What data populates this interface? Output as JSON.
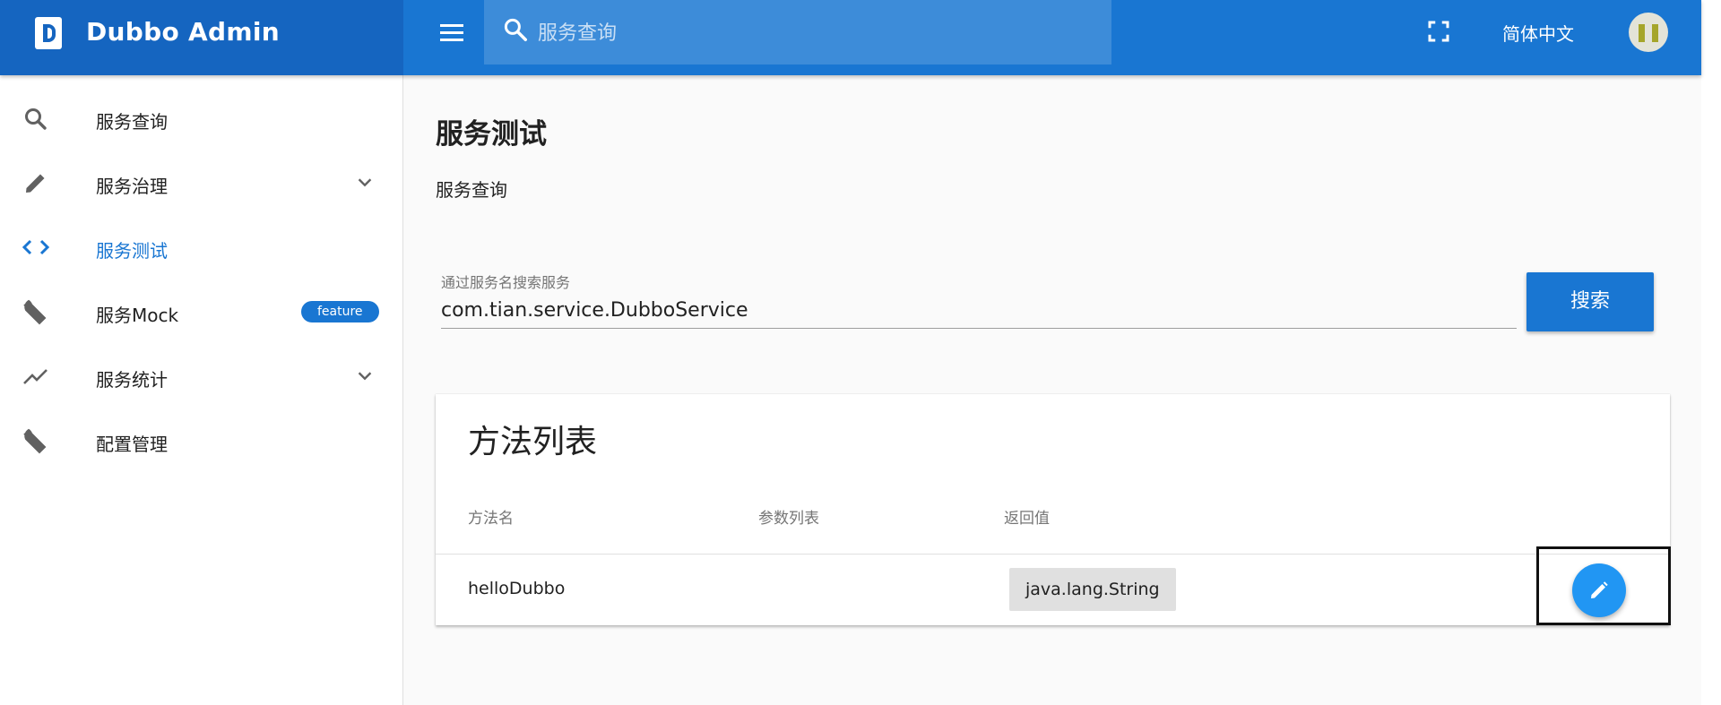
{
  "app": {
    "title": "Dubbo Admin"
  },
  "header": {
    "search_placeholder": "服务查询",
    "language": "简体中文"
  },
  "sidebar": {
    "items": [
      {
        "label": "服务查询",
        "icon": "search-icon"
      },
      {
        "label": "服务治理",
        "icon": "pencil-icon",
        "expandable": true
      },
      {
        "label": "服务测试",
        "icon": "code-icon",
        "active": true
      },
      {
        "label": "服务Mock",
        "icon": "wrench-icon",
        "badge": "feature"
      },
      {
        "label": "服务统计",
        "icon": "trending-icon",
        "expandable": true
      },
      {
        "label": "配置管理",
        "icon": "wrench-icon"
      }
    ]
  },
  "main": {
    "title": "服务测试",
    "breadcrumb": "服务查询",
    "search": {
      "label": "通过服务名搜索服务",
      "value": "com.tian.service.DubboService",
      "button": "搜索"
    },
    "methods": {
      "title": "方法列表",
      "columns": [
        "方法名",
        "参数列表",
        "返回值"
      ],
      "rows": [
        {
          "method": "helloDubbo",
          "params": "",
          "return_type": "java.lang.String"
        }
      ]
    }
  },
  "colors": {
    "primary": "#1976d2",
    "brand_dark": "#1565c0",
    "fab": "#2196f3"
  }
}
